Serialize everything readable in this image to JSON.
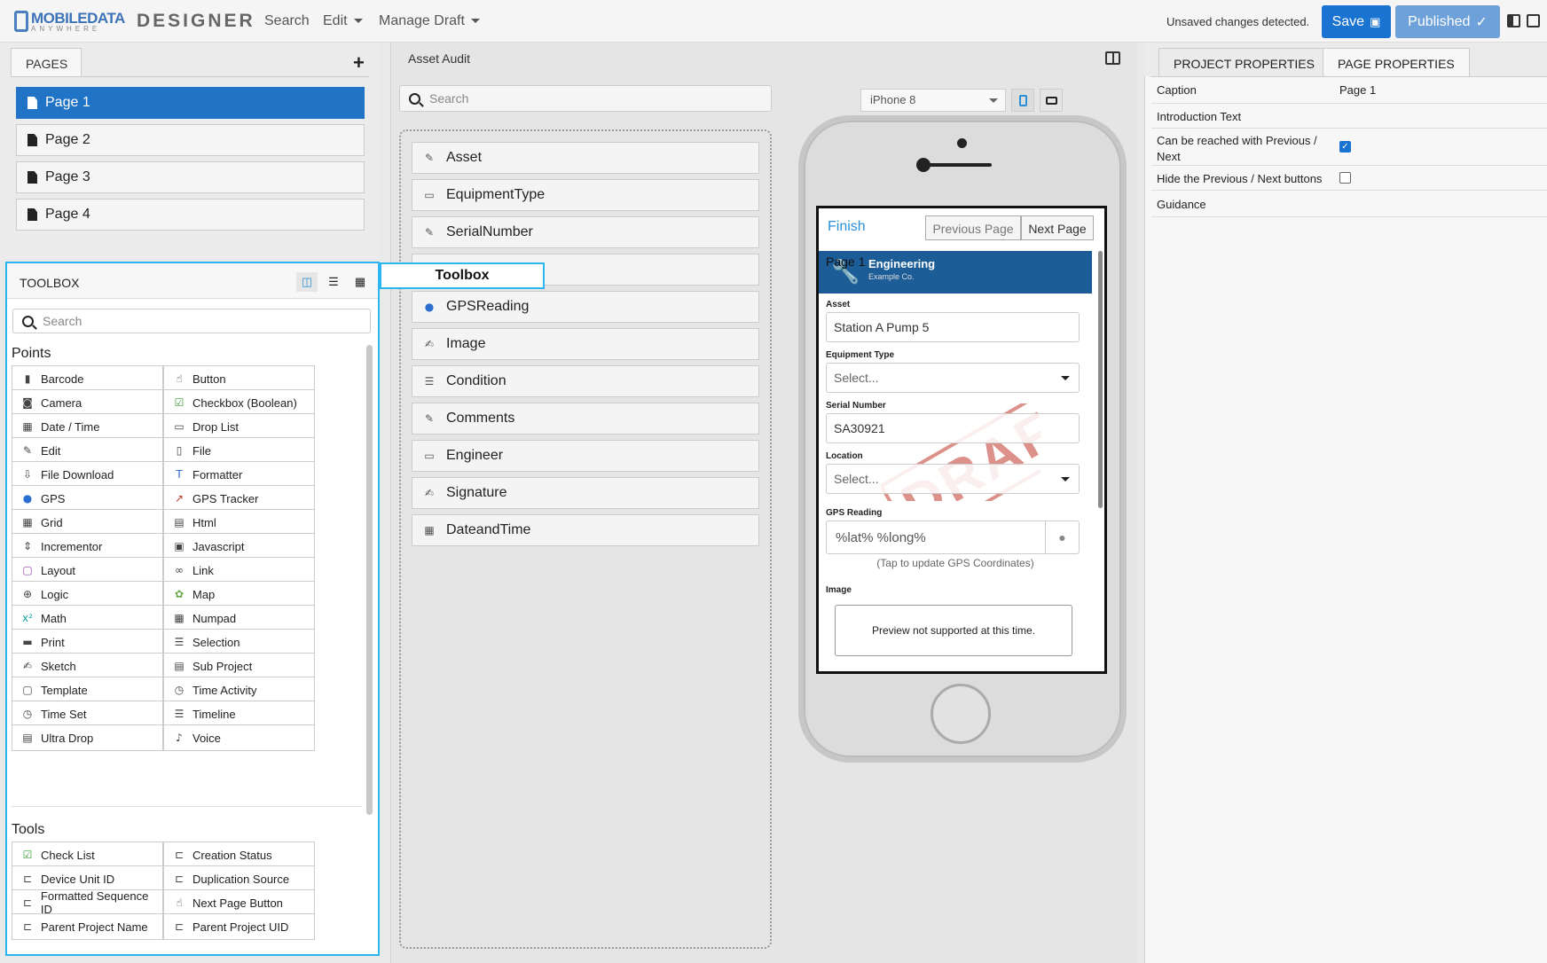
{
  "header": {
    "logo_main": "MOBILEDATA",
    "logo_sub": "ANYWHERE",
    "app_name": "DESIGNER",
    "menu": [
      "Search",
      "Edit",
      "Manage Draft"
    ],
    "unsaved": "Unsaved changes detected.",
    "save_label": "Save",
    "published_label": "Published"
  },
  "pages": {
    "tab": "PAGES",
    "items": [
      "Page 1",
      "Page 2",
      "Page 3",
      "Page 4"
    ]
  },
  "toolbox": {
    "title": "TOOLBOX",
    "tooltip": "Toolbox",
    "search_placeholder": "Search",
    "points_title": "Points",
    "points": [
      {
        "label": "Barcode",
        "icon": "barcode-icon"
      },
      {
        "label": "Button",
        "icon": "button-icon"
      },
      {
        "label": "Camera",
        "icon": "camera-icon"
      },
      {
        "label": "Checkbox (Boolean)",
        "icon": "checkbox-icon"
      },
      {
        "label": "Date / Time",
        "icon": "calendar-icon"
      },
      {
        "label": "Drop List",
        "icon": "droplist-icon"
      },
      {
        "label": "Edit",
        "icon": "edit-icon"
      },
      {
        "label": "File",
        "icon": "file-icon"
      },
      {
        "label": "File Download",
        "icon": "download-icon"
      },
      {
        "label": "Formatter",
        "icon": "formatter-icon"
      },
      {
        "label": "GPS",
        "icon": "gps-pin-icon"
      },
      {
        "label": "GPS Tracker",
        "icon": "gps-tracker-icon"
      },
      {
        "label": "Grid",
        "icon": "grid-icon"
      },
      {
        "label": "Html",
        "icon": "html-icon"
      },
      {
        "label": "Incrementor",
        "icon": "incrementor-icon"
      },
      {
        "label": "Javascript",
        "icon": "javascript-icon"
      },
      {
        "label": "Layout",
        "icon": "layout-icon"
      },
      {
        "label": "Link",
        "icon": "link-icon"
      },
      {
        "label": "Logic",
        "icon": "logic-icon"
      },
      {
        "label": "Map",
        "icon": "map-icon"
      },
      {
        "label": "Math",
        "icon": "math-icon"
      },
      {
        "label": "Numpad",
        "icon": "numpad-icon"
      },
      {
        "label": "Print",
        "icon": "print-icon"
      },
      {
        "label": "Selection",
        "icon": "selection-icon"
      },
      {
        "label": "Sketch",
        "icon": "sketch-icon"
      },
      {
        "label": "Sub Project",
        "icon": "subproject-icon"
      },
      {
        "label": "Template",
        "icon": "template-icon"
      },
      {
        "label": "Time Activity",
        "icon": "time-activity-icon"
      },
      {
        "label": "Time Set",
        "icon": "clock-icon"
      },
      {
        "label": "Timeline",
        "icon": "timeline-icon"
      },
      {
        "label": "Ultra Drop",
        "icon": "ultradrop-icon"
      },
      {
        "label": "Voice",
        "icon": "microphone-icon"
      }
    ],
    "tools_title": "Tools",
    "tools": [
      {
        "label": "Check List",
        "icon": "checklist-icon"
      },
      {
        "label": "Creation Status",
        "icon": "tool-icon"
      },
      {
        "label": "Device Unit ID",
        "icon": "tool-icon"
      },
      {
        "label": "Duplication Source",
        "icon": "tool-icon"
      },
      {
        "label": "Formatted Sequence ID",
        "icon": "tool-icon"
      },
      {
        "label": "Next Page Button",
        "icon": "button-icon"
      },
      {
        "label": "Parent Project Name",
        "icon": "tool-icon"
      },
      {
        "label": "Parent Project UID",
        "icon": "tool-icon"
      }
    ]
  },
  "canvas": {
    "title": "Asset Audit",
    "search_placeholder": "Search",
    "fields": [
      {
        "label": "Asset",
        "icon": "edit-icon"
      },
      {
        "label": "EquipmentType",
        "icon": "droplist-icon"
      },
      {
        "label": "SerialNumber",
        "icon": "edit-icon"
      },
      {
        "label": "",
        "icon": ""
      },
      {
        "label": "GPSReading",
        "icon": "gps-pin-icon"
      },
      {
        "label": "Image",
        "icon": "sketch-icon"
      },
      {
        "label": "Condition",
        "icon": "selection-icon"
      },
      {
        "label": "Comments",
        "icon": "edit-icon"
      },
      {
        "label": "Engineer",
        "icon": "droplist-icon"
      },
      {
        "label": "Signature",
        "icon": "sketch-icon"
      },
      {
        "label": "DateandTime",
        "icon": "calendar-icon"
      }
    ]
  },
  "preview": {
    "device": "iPhone 8",
    "finish": "Finish",
    "prev_page": "Previous Page",
    "next_page": "Next Page",
    "page_label": "Page 1",
    "brand_name": "Engineering",
    "brand_sub": "Example Co.",
    "asset_label": "Asset",
    "asset_value": "Station A Pump 5",
    "equipment_label": "Equipment Type",
    "equipment_value": "Select...",
    "serial_label": "Serial Number",
    "serial_value": "SA30921",
    "location_label": "Location",
    "location_value": "Select...",
    "gps_label": "GPS Reading",
    "gps_value": "%lat% %long%",
    "gps_hint": "(Tap to update GPS Coordinates)",
    "image_label": "Image",
    "image_preview": "Preview not supported at this time.",
    "watermark": "DRAFT"
  },
  "properties": {
    "tabs": [
      "PROJECT PROPERTIES",
      "PAGE PROPERTIES"
    ],
    "rows": [
      {
        "key": "Caption",
        "value": "Page 1"
      },
      {
        "key": "Introduction Text",
        "value": ""
      },
      {
        "key": "Can be reached with Previous / Next",
        "checked": true
      },
      {
        "key": "Hide the Previous / Next buttons",
        "checked": false
      },
      {
        "key": "Guidance",
        "value": ""
      }
    ]
  },
  "colors": {
    "accent": "#2174c5",
    "highlight": "#2bb6f0",
    "watermark": "#c0392b"
  }
}
